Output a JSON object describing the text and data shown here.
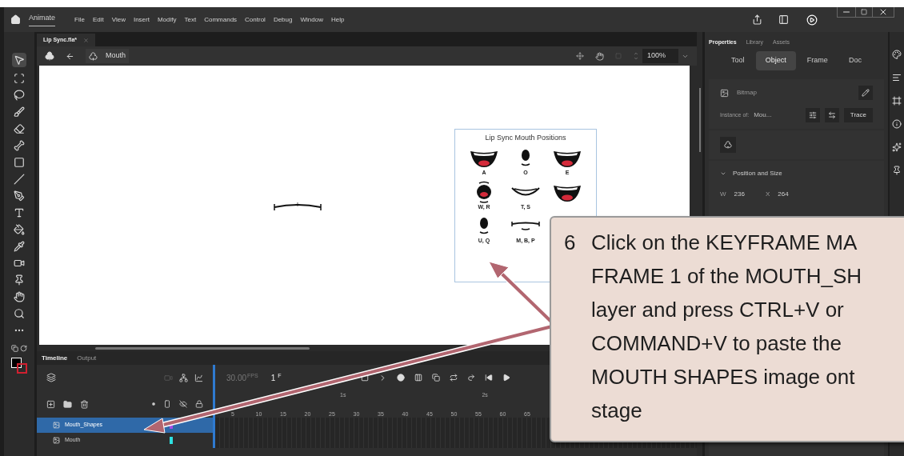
{
  "app": {
    "name": "Animate"
  },
  "menu": [
    "File",
    "Edit",
    "View",
    "Insert",
    "Modify",
    "Text",
    "Commands",
    "Control",
    "Debug",
    "Window",
    "Help"
  ],
  "document_tab": {
    "title": "Lip Sync.fla*"
  },
  "edit_bar": {
    "symbol": "Mouth",
    "zoom": "100%"
  },
  "stage": {
    "image": {
      "title": "Lip Sync Mouth Positions",
      "shapes": [
        {
          "label": "A",
          "kind": "open"
        },
        {
          "label": "O",
          "kind": "round"
        },
        {
          "label": "E",
          "kind": "open"
        },
        {
          "label": "W, R",
          "kind": "wr"
        },
        {
          "label": "T, S",
          "kind": "smile"
        },
        {
          "kind": "open"
        },
        {
          "label": "U, Q",
          "kind": "round"
        },
        {
          "label": "M, B, P",
          "kind": "flat"
        }
      ]
    }
  },
  "properties": {
    "tabs": [
      {
        "label": "Properties",
        "selected": true
      },
      {
        "label": "Library",
        "selected": false
      },
      {
        "label": "Assets",
        "selected": false
      }
    ],
    "mode_tabs": [
      {
        "label": "Tool",
        "selected": false
      },
      {
        "label": "Object",
        "selected": true
      },
      {
        "label": "Frame",
        "selected": false
      },
      {
        "label": "Doc",
        "selected": false
      }
    ],
    "type": "Bitmap",
    "instance_label": "Instance of:",
    "instance_value": "Mou...",
    "trace_button": "Trace",
    "section": {
      "title": "Position and Size",
      "expanded": true
    },
    "fields": [
      {
        "label": "W",
        "value": "236"
      },
      {
        "label": "X",
        "value": "264"
      }
    ]
  },
  "timeline": {
    "tabs": [
      {
        "label": "Timeline",
        "selected": true
      },
      {
        "label": "Output",
        "selected": false
      }
    ],
    "fps": "30.00",
    "fps_unit": "FPS",
    "frame": "1",
    "frame_unit": "F",
    "seconds": [
      "1s",
      "2s"
    ],
    "frame_numbers": [
      "5",
      "10",
      "15",
      "20",
      "25",
      "30",
      "35",
      "40",
      "45",
      "50",
      "55",
      "60",
      "65"
    ],
    "layers": [
      {
        "name": "Mouth_Shapes",
        "selected": true,
        "color": "#a64de6"
      },
      {
        "name": "Mouth",
        "selected": false,
        "color": "#2ee0e0"
      }
    ]
  },
  "callout": {
    "number": "6",
    "lines": [
      "Click on the KEYFRAME MA",
      "FRAME 1 of the MOUTH_SH",
      "layer and press CTRL+V or",
      "COMMAND+V to paste the",
      "MOUTH SHAPES image ont",
      "stage"
    ]
  }
}
